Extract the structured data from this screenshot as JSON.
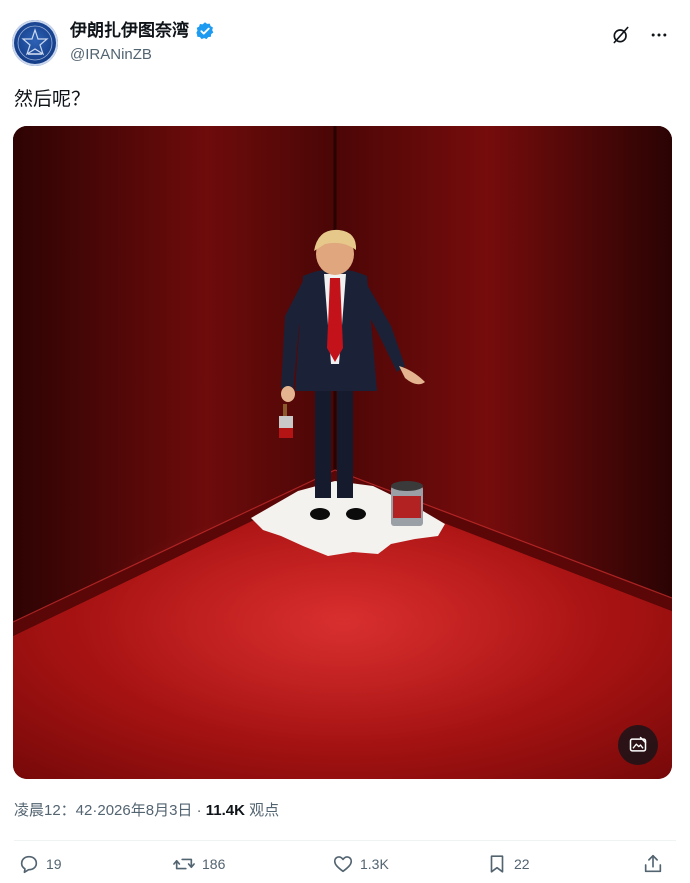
{
  "author": {
    "display_name": "伊朗扎伊图奈湾",
    "handle": "@IRANinZB",
    "verified": true,
    "avatar_icon": "government-emblem-icon"
  },
  "header_icons": [
    "grok-icon",
    "more-icon"
  ],
  "tweet": {
    "text": "然后呢？"
  },
  "media": {
    "alt_button_icon": "image-edit-icon"
  },
  "meta": {
    "time": "凌晨12：42",
    "separator": "·",
    "date": "2026年8月3日",
    "views_count": "11.4K",
    "views_label": "观点"
  },
  "actions": {
    "replies": "19",
    "reposts": "186",
    "likes": "1.3K",
    "bookmarks": "22"
  },
  "colors": {
    "verified": "#1d9bf0",
    "secondary_text": "#536471",
    "room_red": "#8e0f0f",
    "paint_white": "#f4f2ee"
  }
}
